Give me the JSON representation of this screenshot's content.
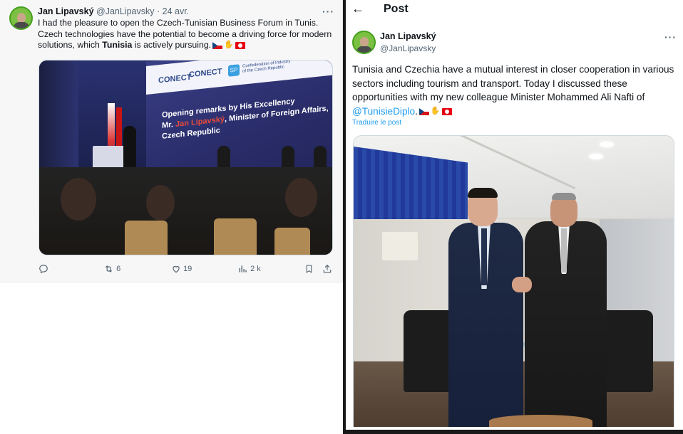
{
  "left_tweet": {
    "author_name": "Jan Lipavský",
    "author_handle": "@JanLipavsky",
    "separator": "·",
    "date": "24 avr.",
    "more_label": "···",
    "text_part1": "I had the pleasure to open the Czech-Tunisian Business Forum in Tunis. Czech technologies have the potential to become a driving force for modern solutions, which ",
    "text_bold": "Tunisia",
    "text_part2": " is actively pursuing.",
    "image": {
      "logo1": "CONECT",
      "logo2": "CONECT",
      "logo_sp": "SP",
      "logo3": "Confederation of Industry of the Czech Republic",
      "slide_line1": "Opening remarks by His Excellency",
      "slide_line2_pre": "Mr. ",
      "slide_line2_hl": "Jan Lipavský",
      "slide_line2_post": ", Minister of Foreign Affairs,",
      "slide_line3": "Czech Republic"
    },
    "actions": {
      "reply_count": "",
      "retweet_count": "6",
      "like_count": "19",
      "views_count": "2 k"
    }
  },
  "right_post": {
    "header_title": "Post",
    "author_name": "Jan Lipavský",
    "author_handle": "@JanLipavsky",
    "more_label": "···",
    "text_main": "Tunisia and Czechia have a mutual interest in closer cooperation in various sectors including tourism and transport. Today I discussed these opportunities with my new colleague Minister Mohammed Ali Nafti of ",
    "mention": "@TunisieDiplo",
    "text_end": ".",
    "translate_label": "Traduire le post"
  },
  "colors": {
    "link": "#1d9bf0",
    "text": "#0f1419",
    "muted": "#536471",
    "avatar_bg": "#7bc043"
  }
}
